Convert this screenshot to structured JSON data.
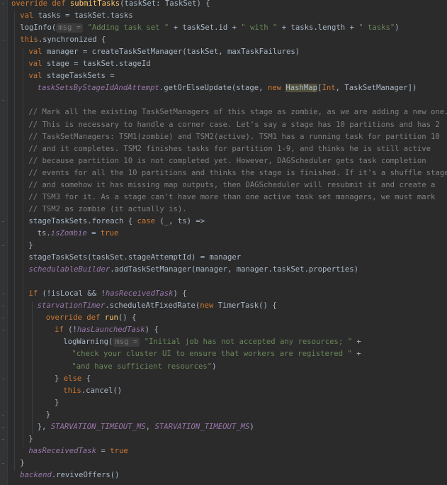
{
  "editor": {
    "language": "scala",
    "lines": [
      {
        "indent": 0,
        "segments": [
          {
            "t": "override def ",
            "c": "kw"
          },
          {
            "t": "submitTasks",
            "c": "fn"
          },
          {
            "t": "(taskSet: TaskSet) {",
            "c": ""
          }
        ]
      },
      {
        "indent": 1,
        "segments": [
          {
            "t": "val ",
            "c": "kw"
          },
          {
            "t": "tasks = taskSet.tasks",
            "c": ""
          }
        ]
      },
      {
        "indent": 1,
        "segments": [
          {
            "t": "logInfo(",
            "c": ""
          },
          {
            "t": "msg =",
            "c": "hint"
          },
          {
            "t": " ",
            "c": ""
          },
          {
            "t": "\"Adding task set \"",
            "c": "str"
          },
          {
            "t": " + taskSet.id + ",
            "c": ""
          },
          {
            "t": "\" with \"",
            "c": "str"
          },
          {
            "t": " + tasks.length + ",
            "c": ""
          },
          {
            "t": "\" tasks\"",
            "c": "str"
          },
          {
            "t": ")",
            "c": ""
          }
        ]
      },
      {
        "indent": 1,
        "segments": [
          {
            "t": "this",
            "c": "kw"
          },
          {
            "t": ".synchronized {",
            "c": ""
          }
        ]
      },
      {
        "indent": 2,
        "segments": [
          {
            "t": "val ",
            "c": "kw"
          },
          {
            "t": "manager = createTaskSetManager(taskSet, maxTaskFailures)",
            "c": ""
          }
        ]
      },
      {
        "indent": 2,
        "segments": [
          {
            "t": "val ",
            "c": "kw"
          },
          {
            "t": "stage = taskSet.stageId",
            "c": ""
          }
        ]
      },
      {
        "indent": 2,
        "segments": [
          {
            "t": "val ",
            "c": "kw"
          },
          {
            "t": "stageTaskSets =",
            "c": ""
          }
        ]
      },
      {
        "indent": 3,
        "segments": [
          {
            "t": "taskSetsByStageIdAndAttempt",
            "c": "it"
          },
          {
            "t": ".getOrElseUpdate(stage, ",
            "c": ""
          },
          {
            "t": "new ",
            "c": "kw"
          },
          {
            "t": "HashMap",
            "c": "hl"
          },
          {
            "t": "[",
            "c": ""
          },
          {
            "t": "Int",
            "c": "kw"
          },
          {
            "t": ", TaskSetManager])",
            "c": ""
          }
        ]
      },
      {
        "indent": 0,
        "segments": []
      },
      {
        "indent": 2,
        "segments": [
          {
            "t": "// Mark all the existing TaskSetManagers of this stage as zombie, as we are adding a new one.",
            "c": "cm"
          }
        ]
      },
      {
        "indent": 2,
        "segments": [
          {
            "t": "// This is necessary to handle a corner case. Let's say a stage has 10 partitions and has 2",
            "c": "cm"
          }
        ]
      },
      {
        "indent": 2,
        "segments": [
          {
            "t": "// TaskSetManagers: TSM1(zombie) and TSM2(active). TSM1 has a running task for partition 10",
            "c": "cm"
          }
        ]
      },
      {
        "indent": 2,
        "segments": [
          {
            "t": "// and it completes. TSM2 finishes tasks for partition 1-9, and thinks he is still active",
            "c": "cm"
          }
        ]
      },
      {
        "indent": 2,
        "segments": [
          {
            "t": "// because partition 10 is not completed yet. However, DAGScheduler gets task completion",
            "c": "cm"
          }
        ]
      },
      {
        "indent": 2,
        "segments": [
          {
            "t": "// events for all the 10 partitions and thinks the stage is finished. If it's a shuffle stage",
            "c": "cm"
          }
        ]
      },
      {
        "indent": 2,
        "segments": [
          {
            "t": "// and somehow it has missing map outputs, then DAGScheduler will resubmit it and create a",
            "c": "cm"
          }
        ]
      },
      {
        "indent": 2,
        "segments": [
          {
            "t": "// TSM3 for it. As a stage can't have more than one active task set managers, we must mark",
            "c": "cm"
          }
        ]
      },
      {
        "indent": 2,
        "segments": [
          {
            "t": "// TSM2 as zombie (it actually is).",
            "c": "cm"
          }
        ]
      },
      {
        "indent": 2,
        "segments": [
          {
            "t": "stageTaskSets.foreach { ",
            "c": ""
          },
          {
            "t": "case ",
            "c": "kw"
          },
          {
            "t": "(_, ts) =>",
            "c": ""
          }
        ]
      },
      {
        "indent": 3,
        "segments": [
          {
            "t": "ts.",
            "c": ""
          },
          {
            "t": "isZombie",
            "c": "it"
          },
          {
            "t": " = ",
            "c": ""
          },
          {
            "t": "true",
            "c": "kw"
          }
        ]
      },
      {
        "indent": 2,
        "segments": [
          {
            "t": "}",
            "c": ""
          }
        ]
      },
      {
        "indent": 2,
        "segments": [
          {
            "t": "stageTaskSets(taskSet.stageAttemptId) = manager",
            "c": ""
          }
        ]
      },
      {
        "indent": 2,
        "segments": [
          {
            "t": "schedulableBuilder",
            "c": "it"
          },
          {
            "t": ".addTaskSetManager(manager, manager.taskSet.properties)",
            "c": ""
          }
        ]
      },
      {
        "indent": 0,
        "segments": []
      },
      {
        "indent": 2,
        "segments": [
          {
            "t": "if ",
            "c": "kw"
          },
          {
            "t": "(!isLocal && !",
            "c": ""
          },
          {
            "t": "hasReceivedTask",
            "c": "it"
          },
          {
            "t": ") {",
            "c": ""
          }
        ]
      },
      {
        "indent": 3,
        "segments": [
          {
            "t": "starvationTimer",
            "c": "it"
          },
          {
            "t": ".scheduleAtFixedRate(",
            "c": ""
          },
          {
            "t": "new ",
            "c": "kw"
          },
          {
            "t": "TimerTask() {",
            "c": ""
          }
        ]
      },
      {
        "indent": 4,
        "segments": [
          {
            "t": "override def ",
            "c": "kw"
          },
          {
            "t": "run",
            "c": "fn"
          },
          {
            "t": "() {",
            "c": ""
          }
        ]
      },
      {
        "indent": 5,
        "segments": [
          {
            "t": "if ",
            "c": "kw"
          },
          {
            "t": "(!",
            "c": ""
          },
          {
            "t": "hasLaunchedTask",
            "c": "it"
          },
          {
            "t": ") {",
            "c": ""
          }
        ]
      },
      {
        "indent": 6,
        "segments": [
          {
            "t": "logWarning(",
            "c": ""
          },
          {
            "t": "msg =",
            "c": "hint"
          },
          {
            "t": " ",
            "c": ""
          },
          {
            "t": "\"Initial job has not accepted any resources; \"",
            "c": "str"
          },
          {
            "t": " +",
            "c": ""
          }
        ]
      },
      {
        "indent": 7,
        "segments": [
          {
            "t": "\"check your cluster UI to ensure that workers are registered \"",
            "c": "str"
          },
          {
            "t": " +",
            "c": ""
          }
        ]
      },
      {
        "indent": 7,
        "segments": [
          {
            "t": "\"and have sufficient resources\"",
            "c": "str"
          },
          {
            "t": ")",
            "c": ""
          }
        ]
      },
      {
        "indent": 5,
        "segments": [
          {
            "t": "} ",
            "c": ""
          },
          {
            "t": "else ",
            "c": "kw"
          },
          {
            "t": "{",
            "c": ""
          }
        ]
      },
      {
        "indent": 6,
        "segments": [
          {
            "t": "this",
            "c": "kw"
          },
          {
            "t": ".cancel()",
            "c": ""
          }
        ]
      },
      {
        "indent": 5,
        "segments": [
          {
            "t": "}",
            "c": ""
          }
        ]
      },
      {
        "indent": 4,
        "segments": [
          {
            "t": "}",
            "c": ""
          }
        ]
      },
      {
        "indent": 3,
        "segments": [
          {
            "t": "}, ",
            "c": ""
          },
          {
            "t": "STARVATION_TIMEOUT_MS",
            "c": "it"
          },
          {
            "t": ", ",
            "c": ""
          },
          {
            "t": "STARVATION_TIMEOUT_MS",
            "c": "it"
          },
          {
            "t": ")",
            "c": ""
          }
        ]
      },
      {
        "indent": 2,
        "segments": [
          {
            "t": "}",
            "c": ""
          }
        ]
      },
      {
        "indent": 2,
        "segments": [
          {
            "t": "hasReceivedTask",
            "c": "it"
          },
          {
            "t": " = ",
            "c": ""
          },
          {
            "t": "true",
            "c": "kw"
          }
        ]
      },
      {
        "indent": 1,
        "segments": [
          {
            "t": "}",
            "c": ""
          }
        ]
      },
      {
        "indent": 1,
        "segments": [
          {
            "t": "backend",
            "c": "it"
          },
          {
            "t": ".reviveOffers()",
            "c": ""
          }
        ]
      }
    ]
  },
  "colors": {
    "background": "#2b2b2b",
    "text": "#a9b7c6",
    "keyword": "#cc7832",
    "function": "#ffc66d",
    "string": "#6a8759",
    "comment": "#808080",
    "field": "#9876aa"
  }
}
